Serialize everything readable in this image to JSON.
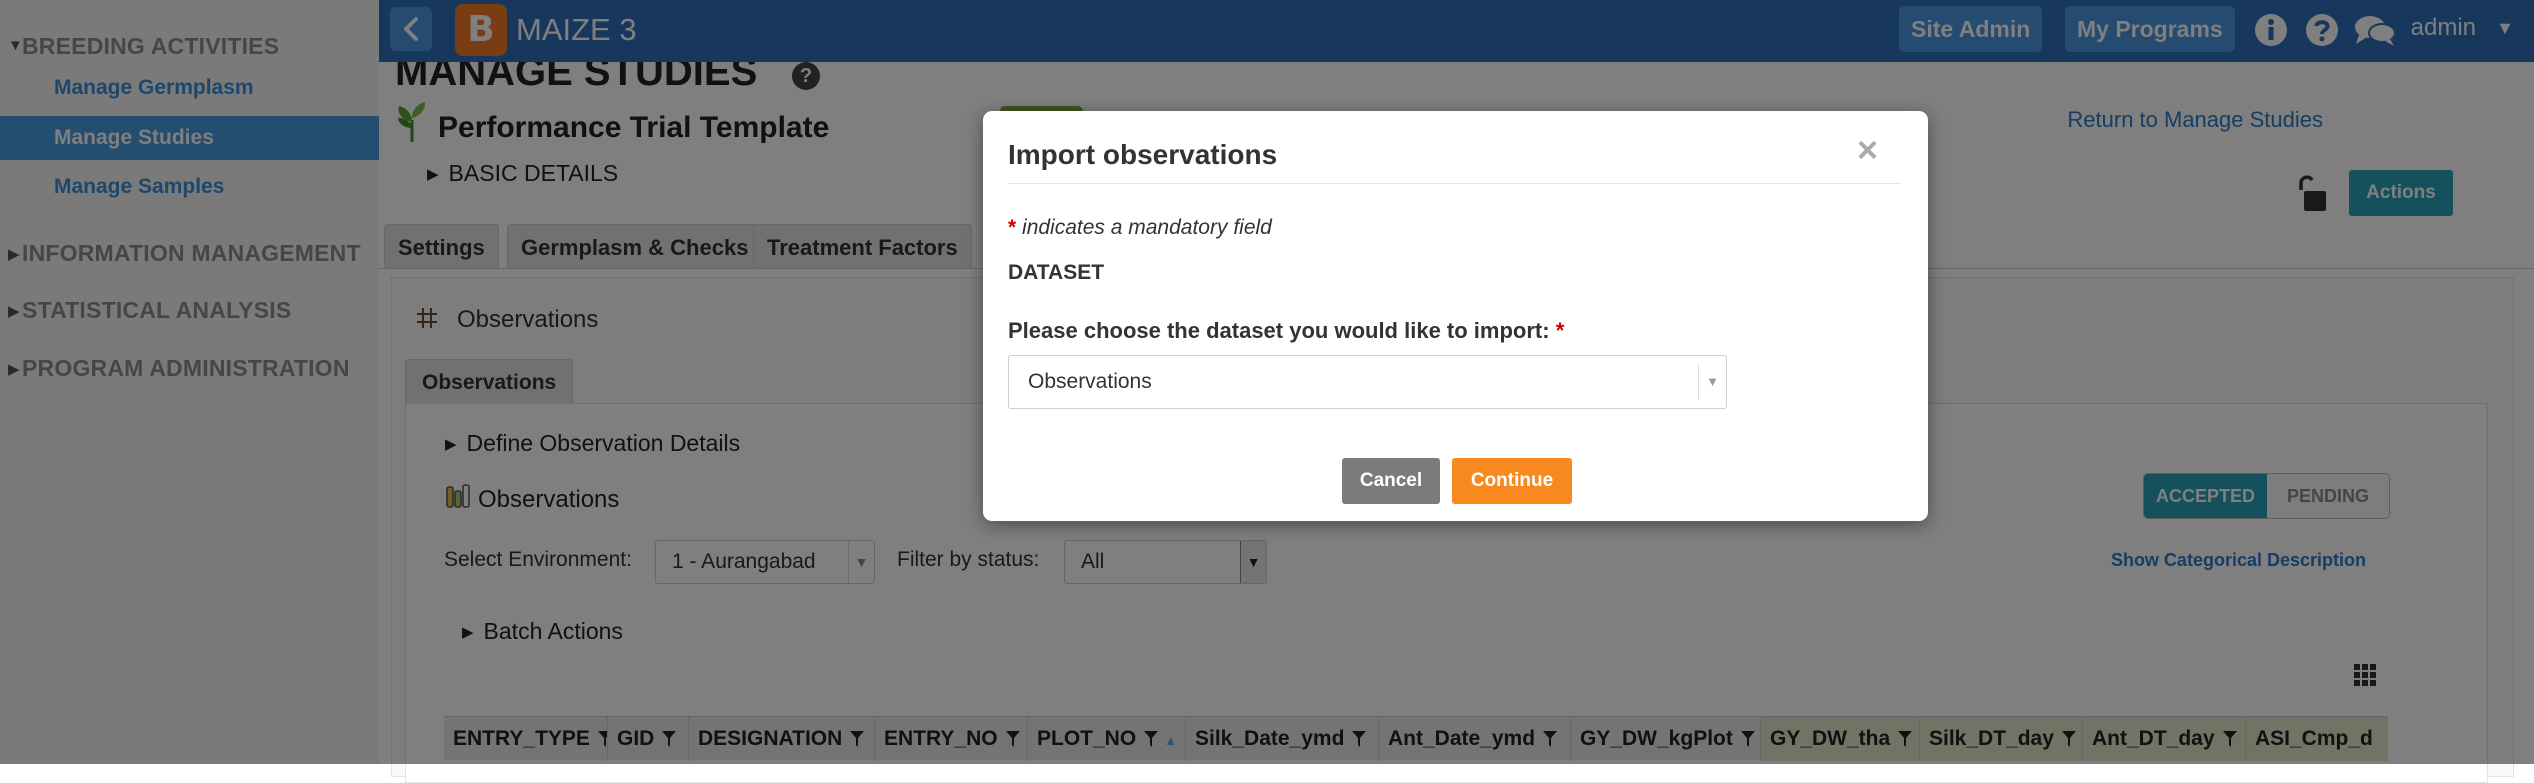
{
  "sidebar": {
    "sections": [
      {
        "label": "BREEDING ACTIVITIES",
        "expanded": true
      },
      {
        "label": "INFORMATION MANAGEMENT",
        "expanded": false
      },
      {
        "label": "STATISTICAL ANALYSIS",
        "expanded": false
      },
      {
        "label": "PROGRAM ADMINISTRATION",
        "expanded": false
      }
    ],
    "items": [
      {
        "label": "Manage Germplasm",
        "active": false
      },
      {
        "label": "Manage Studies",
        "active": true
      },
      {
        "label": "Manage Samples",
        "active": false
      }
    ]
  },
  "topbar": {
    "logo_letter": "B",
    "title": "MAIZE 3",
    "site_admin": "Site Admin",
    "my_programs": "My Programs",
    "user": "admin",
    "icons": [
      "info-icon",
      "help-icon",
      "chat-icon"
    ],
    "colors": {
      "bar": "#2e6fb8",
      "button": "#4a97e0",
      "logo": "#f37a28"
    }
  },
  "page": {
    "title": "MANAGE STUDIES",
    "study_name": "Performance Trial Template",
    "basic_details": "BASIC DETAILS",
    "return_link": "Return to Manage Studies",
    "actions": "Actions",
    "tabs": [
      "Settings",
      "Germplasm & Checks",
      "Treatment Factors"
    ],
    "observations_heading": "Observations",
    "subtab": "Observations",
    "define_obs": "Define Observation Details",
    "obs_section": "Observations",
    "select_env_label": "Select Environment:",
    "select_env_value": "1 - Aurangabad",
    "filter_label": "Filter by status:",
    "filter_value": "All",
    "accepted": "ACCEPTED",
    "pending": "PENDING",
    "show_categorical": "Show Categorical Description",
    "batch_actions": "Batch Actions",
    "columns": [
      {
        "label": "ENTRY_TYPE",
        "green": false
      },
      {
        "label": "GID",
        "green": false
      },
      {
        "label": "DESIGNATION",
        "green": false
      },
      {
        "label": "ENTRY_NO",
        "green": false
      },
      {
        "label": "PLOT_NO",
        "green": false
      },
      {
        "label": "Silk_Date_ymd",
        "green": false
      },
      {
        "label": "Ant_Date_ymd",
        "green": false
      },
      {
        "label": "GY_DW_kgPlot",
        "green": false
      },
      {
        "label": "GY_DW_tha",
        "green": true
      },
      {
        "label": "Silk_DT_day",
        "green": true
      },
      {
        "label": "Ant_DT_day",
        "green": true
      },
      {
        "label": "ASI_Cmp_d",
        "green": true
      }
    ],
    "colors": {
      "accent": "#2aa2b8",
      "link": "#2d7bc4",
      "status": "#7eaa3b"
    }
  },
  "modal": {
    "title": "Import observations",
    "close": "×",
    "mandatory_star": "*",
    "mandatory_text": "indicates a mandatory field",
    "dataset_label": "DATASET",
    "question": "Please choose the dataset you would like to import:",
    "question_star": "*",
    "select_value": "Observations",
    "cancel": "Cancel",
    "continue": "Continue",
    "colors": {
      "continue": "#f7891f",
      "cancel": "#7b7b7b",
      "required": "#cc0000"
    }
  }
}
